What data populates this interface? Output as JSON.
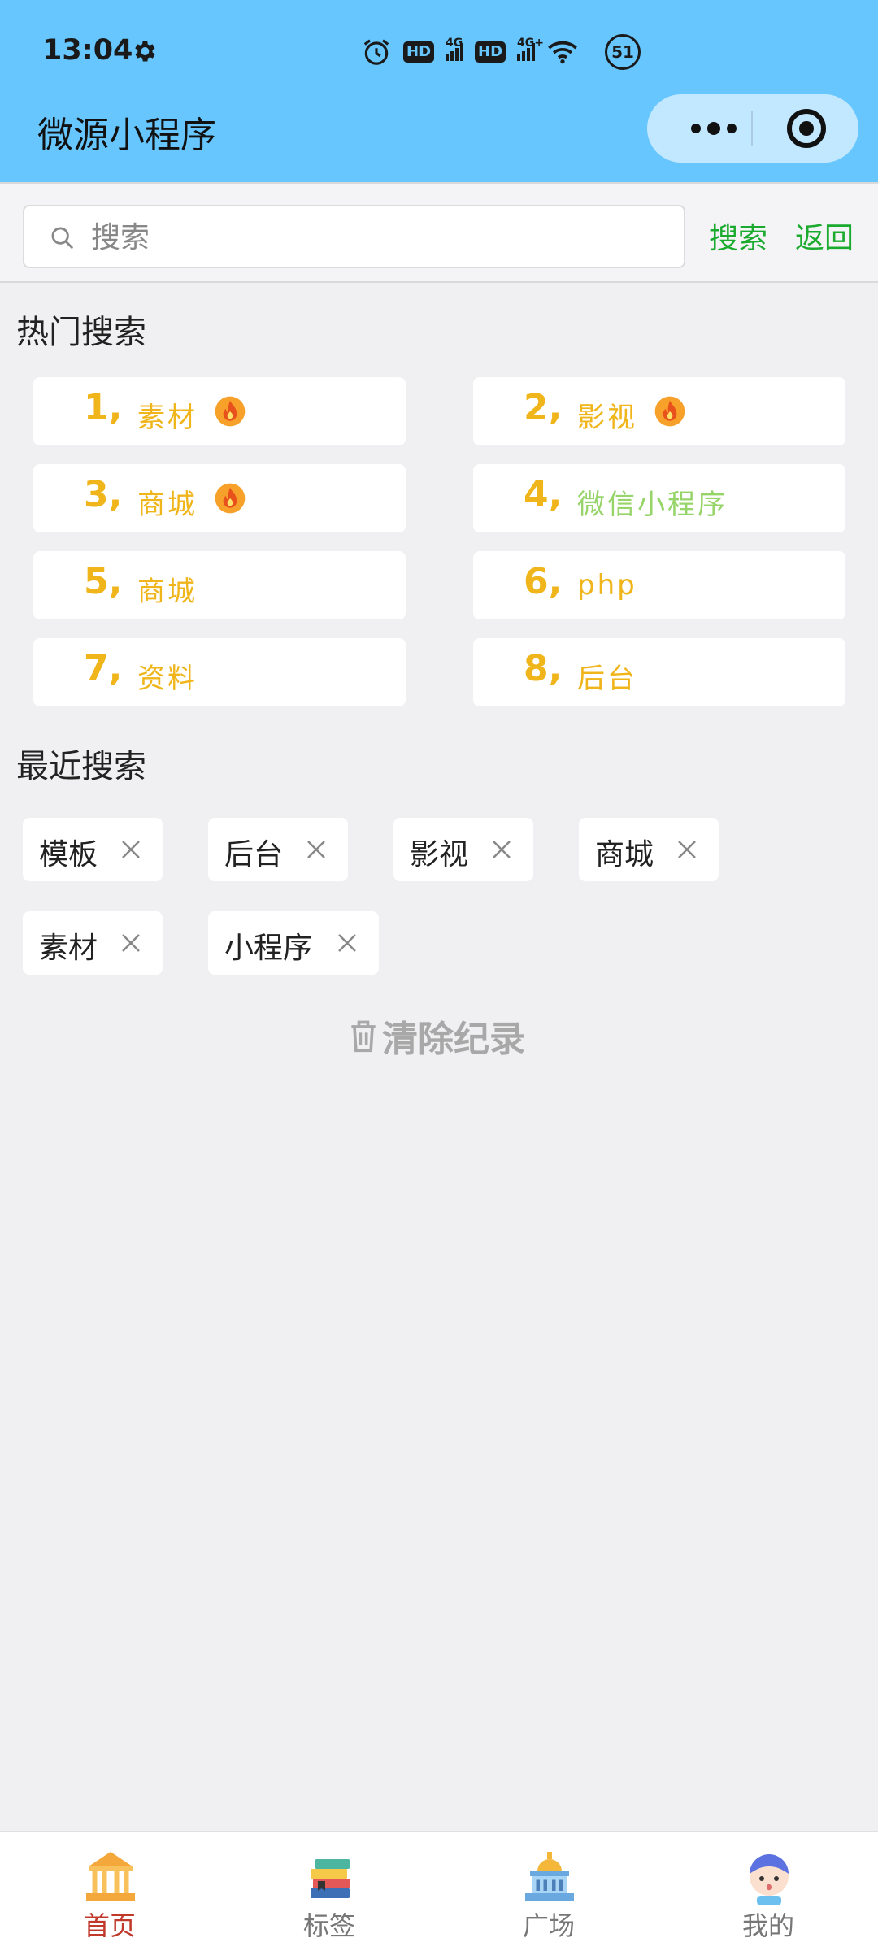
{
  "status_bar": {
    "time": "13:04",
    "hd1": "HD",
    "hd2": "HD",
    "signal1": "4G",
    "signal2": "4G+",
    "battery": "51"
  },
  "app": {
    "title": "微源小程序"
  },
  "search": {
    "placeholder": "搜索",
    "value": "",
    "search_label": "搜索",
    "back_label": "返回"
  },
  "hot_search": {
    "title": "热门搜索",
    "items": [
      {
        "num": "1,",
        "label": "素材",
        "hot": true
      },
      {
        "num": "2,",
        "label": "影视",
        "hot": true
      },
      {
        "num": "3,",
        "label": "商城",
        "hot": true
      },
      {
        "num": "4,",
        "label": "微信小程序",
        "hot": false
      },
      {
        "num": "5,",
        "label": "商城",
        "hot": false
      },
      {
        "num": "6,",
        "label": "php",
        "hot": false
      },
      {
        "num": "7,",
        "label": "资料",
        "hot": false
      },
      {
        "num": "8,",
        "label": "后台",
        "hot": false
      }
    ]
  },
  "recent_search": {
    "title": "最近搜索",
    "tags": [
      "模板",
      "后台",
      "影视",
      "商城",
      "素材",
      "小程序"
    ],
    "clear_label": "清除纪录"
  },
  "tabbar": {
    "tabs": [
      {
        "label": "首页",
        "icon": "temple-icon",
        "active": true
      },
      {
        "label": "标签",
        "icon": "books-icon",
        "active": false
      },
      {
        "label": "广场",
        "icon": "capitol-icon",
        "active": false
      },
      {
        "label": "我的",
        "icon": "avatar-icon",
        "active": false
      }
    ]
  },
  "colors": {
    "header_bg": "#67c6fe",
    "accent_green": "#1aab2e",
    "hot_yellow": "#efb51b",
    "hot_green": "#97d46a",
    "active_tab": "#c0392b"
  }
}
